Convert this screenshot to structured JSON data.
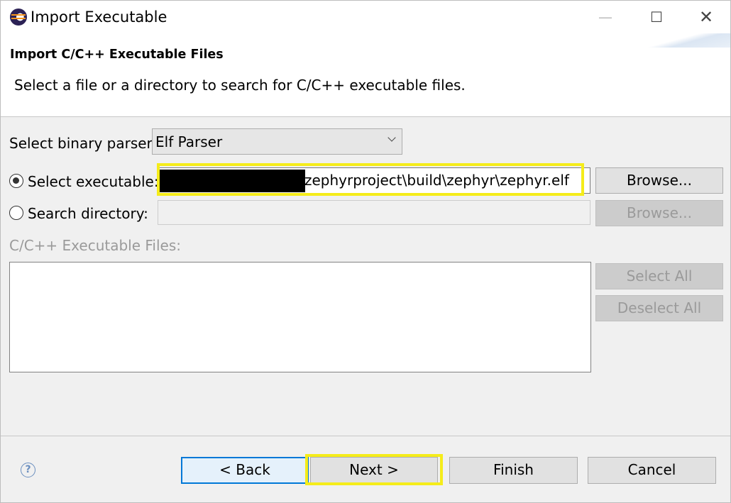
{
  "window": {
    "title": "Import Executable",
    "controls": {
      "minimize": "—",
      "maximize": "☐",
      "close": "✕"
    }
  },
  "header": {
    "title": "Import C/C++ Executable Files",
    "description": "Select a file or a directory to search for C/C++ executable files."
  },
  "parser": {
    "label": "Select binary parser:",
    "value": "Elf Parser"
  },
  "select_executable": {
    "label": "Select executable:",
    "value": "zephyrproject\\build\\zephyr\\zephyr.elf",
    "checked": true,
    "browse_label": "Browse..."
  },
  "search_directory": {
    "label": "Search directory:",
    "value": "",
    "checked": false,
    "browse_label": "Browse..."
  },
  "files": {
    "label": "C/C++ Executable Files:",
    "items": [],
    "select_all_label": "Select All",
    "deselect_all_label": "Deselect All"
  },
  "footer": {
    "help_icon": "?",
    "back_label": "< Back",
    "next_label": "Next >",
    "finish_label": "Finish",
    "cancel_label": "Cancel"
  },
  "colors": {
    "highlight": "#f5ec1a",
    "default_button_border": "#0078d7"
  }
}
